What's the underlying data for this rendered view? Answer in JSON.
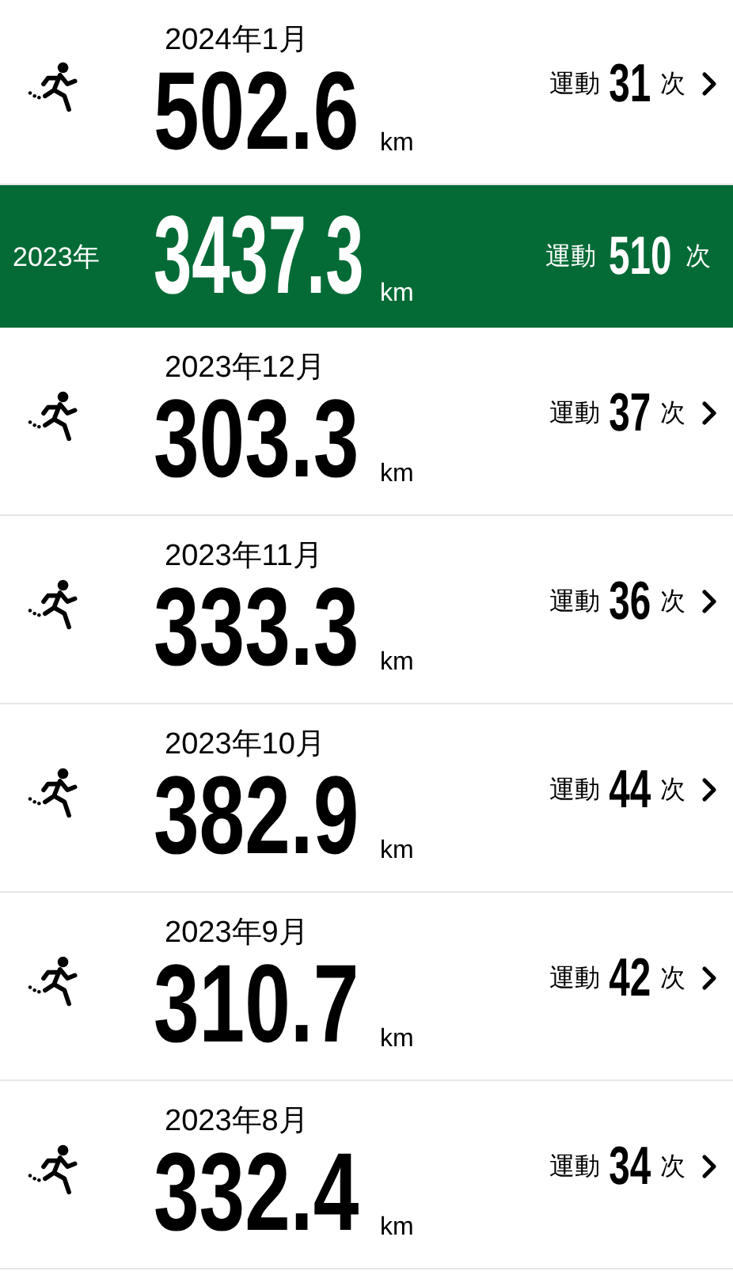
{
  "entries": [
    {
      "kind": "month",
      "period": "2024年1月",
      "distance": "502.6",
      "unit": "km",
      "count_label": "運動",
      "count": "31",
      "count_unit": "次"
    },
    {
      "kind": "year",
      "period": "2023年",
      "distance": "3437.3",
      "unit": "km",
      "count_label": "運動",
      "count": "510",
      "count_unit": "次"
    },
    {
      "kind": "month",
      "period": "2023年12月",
      "distance": "303.3",
      "unit": "km",
      "count_label": "運動",
      "count": "37",
      "count_unit": "次"
    },
    {
      "kind": "month",
      "period": "2023年11月",
      "distance": "333.3",
      "unit": "km",
      "count_label": "運動",
      "count": "36",
      "count_unit": "次"
    },
    {
      "kind": "month",
      "period": "2023年10月",
      "distance": "382.9",
      "unit": "km",
      "count_label": "運動",
      "count": "44",
      "count_unit": "次"
    },
    {
      "kind": "month",
      "period": "2023年9月",
      "distance": "310.7",
      "unit": "km",
      "count_label": "運動",
      "count": "42",
      "count_unit": "次"
    },
    {
      "kind": "month",
      "period": "2023年8月",
      "distance": "332.4",
      "unit": "km",
      "count_label": "運動",
      "count": "34",
      "count_unit": "次"
    }
  ]
}
